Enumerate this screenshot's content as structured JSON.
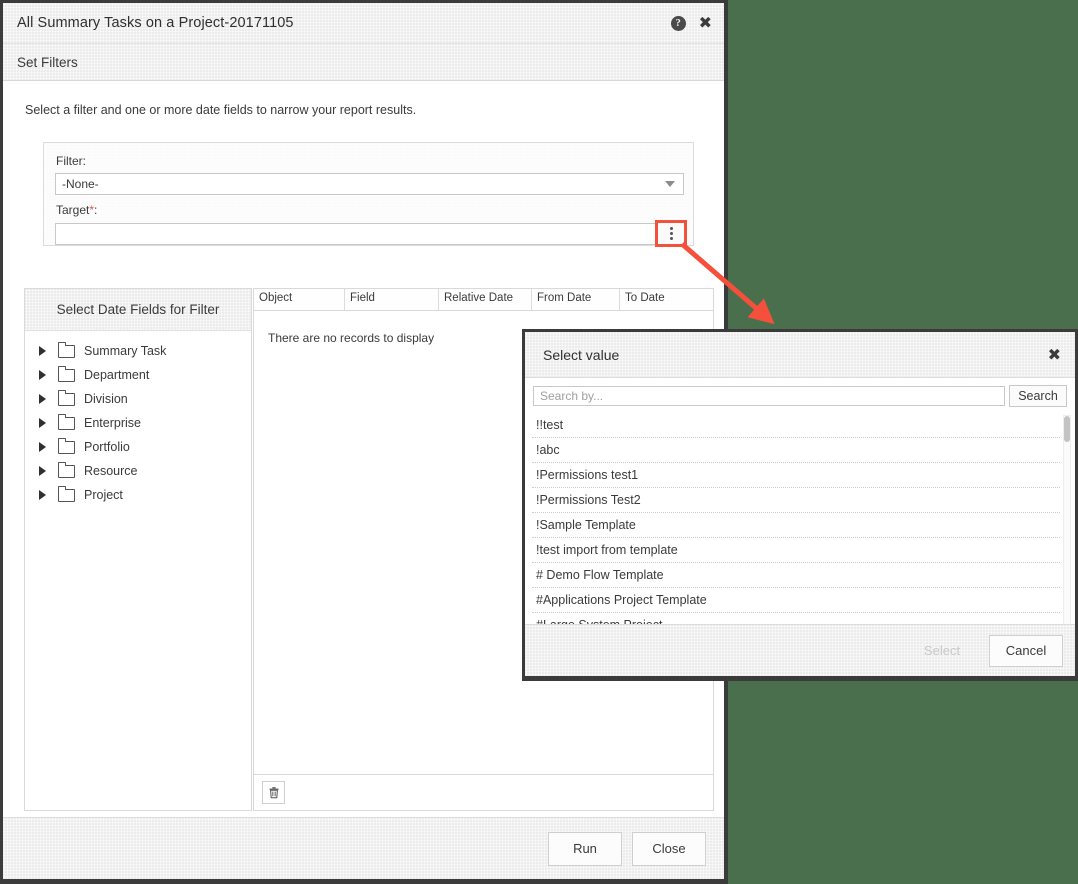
{
  "colors": {
    "page_background": "#4a6f4d",
    "annotation_red": "#f4503c",
    "modal_border": "#3b3b3b",
    "header_grey": "#ececec",
    "required_asterisk": "#d9534f"
  },
  "main_dialog": {
    "title": "All Summary Tasks on a Project-20171105",
    "help_icon": "help-circle-icon",
    "close_icon": "close-icon",
    "subheader": "Set Filters",
    "instructions": "Select a filter and one or more date fields to narrow your report results.",
    "filter_panel": {
      "filter_label": "Filter:",
      "filter_value": "-None-",
      "filter_options": [
        "-None-"
      ],
      "dropdown_icon": "chevron-down-icon",
      "target_label": "Target",
      "target_required_mark": "*",
      "target_label_suffix": ":",
      "target_value": "",
      "target_placeholder": "",
      "ellipsis_button_icon": "vertical-ellipsis-icon"
    },
    "tree_panel": {
      "title": "Select Date Fields for Filter",
      "items": [
        {
          "label": "Summary Task",
          "expander": "triangle-right-icon",
          "icon": "folder-icon"
        },
        {
          "label": "Department",
          "expander": "triangle-right-icon",
          "icon": "folder-icon"
        },
        {
          "label": "Division",
          "expander": "triangle-right-icon",
          "icon": "folder-icon"
        },
        {
          "label": "Enterprise",
          "expander": "triangle-right-icon",
          "icon": "folder-icon"
        },
        {
          "label": "Portfolio",
          "expander": "triangle-right-icon",
          "icon": "folder-icon"
        },
        {
          "label": "Resource",
          "expander": "triangle-right-icon",
          "icon": "folder-icon"
        },
        {
          "label": "Project",
          "expander": "triangle-right-icon",
          "icon": "folder-icon"
        }
      ]
    },
    "grid": {
      "columns": [
        "Object",
        "Field",
        "Relative Date",
        "From Date",
        "To Date"
      ],
      "empty_message": "There are no records to display",
      "rows": [],
      "delete_button_icon": "trash-icon"
    },
    "footer": {
      "run_label": "Run",
      "close_label": "Close"
    }
  },
  "select_value_dialog": {
    "title": "Select value",
    "close_icon": "close-icon",
    "search_value": "",
    "search_placeholder": "Search by...",
    "search_button_label": "Search",
    "items": [
      "!!test",
      "!abc",
      "!Permissions test1",
      "!Permissions Test2",
      "!Sample Template",
      "!test import from template",
      "# Demo Flow Template",
      "#Applications Project Template",
      "#Large System Project"
    ],
    "footer": {
      "select_label": "Select",
      "select_disabled": true,
      "cancel_label": "Cancel"
    },
    "scrollbar": "vertical-scrollbar"
  },
  "annotation": {
    "type": "arrow",
    "description": "red arrow from ellipsis button to Select value dialog"
  }
}
